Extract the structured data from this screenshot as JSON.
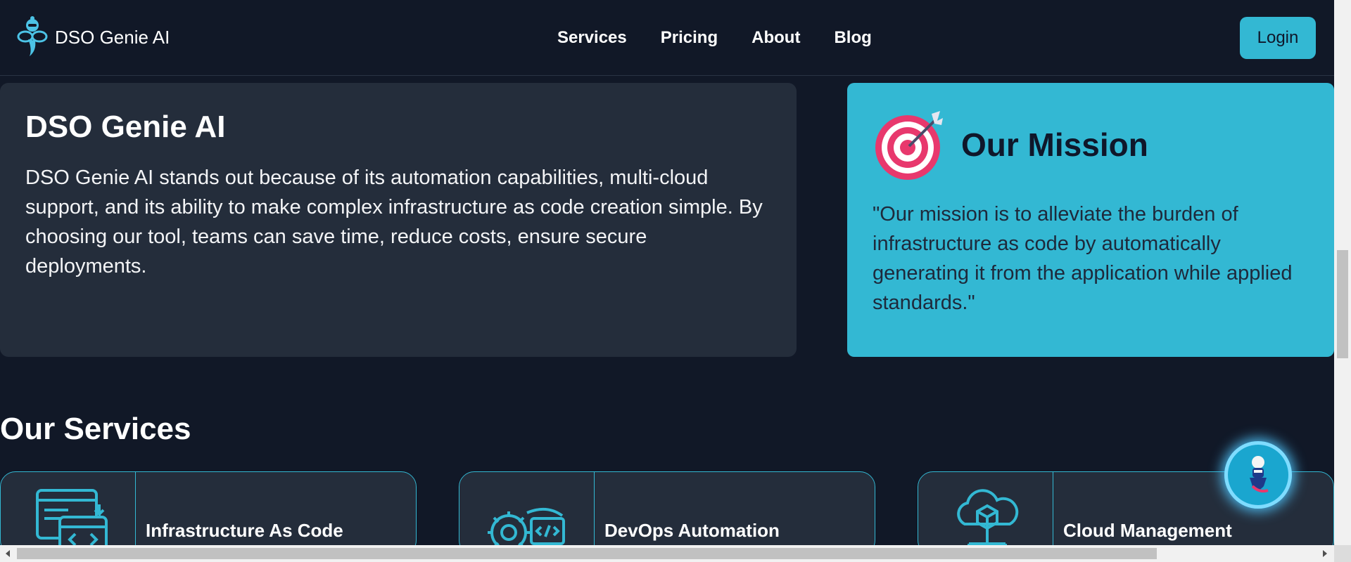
{
  "brand": {
    "name": "DSO Genie AI",
    "logo_icon": "genie-logo-icon"
  },
  "nav": {
    "links": [
      {
        "label": "Services"
      },
      {
        "label": "Pricing"
      },
      {
        "label": "About"
      },
      {
        "label": "Blog"
      }
    ],
    "login_label": "Login"
  },
  "about": {
    "title": "DSO Genie AI",
    "text": "DSO Genie AI stands out because of its automation capabilities, multi-cloud support, and its ability to make complex infrastructure as code creation simple. By choosing our tool, teams can save time, reduce costs, ensure secure deployments."
  },
  "mission": {
    "title": "Our Mission",
    "icon": "target-icon",
    "text": "\"Our mission is to alleviate the burden of infrastructure as code by automatically generating it from the application while applied standards.\""
  },
  "services": {
    "title": "Our Services",
    "items": [
      {
        "label": "Infrastructure As Code",
        "icon": "code-windows-icon"
      },
      {
        "label": "DevOps Automation",
        "icon": "gear-code-icon"
      },
      {
        "label": "Cloud Management",
        "icon": "cloud-box-icon"
      }
    ]
  },
  "chat": {
    "icon": "genie-chat-icon"
  },
  "colors": {
    "background": "#111827",
    "card": "#242d3b",
    "accent": "#33b8d3",
    "dark_text": "#0f172a"
  }
}
